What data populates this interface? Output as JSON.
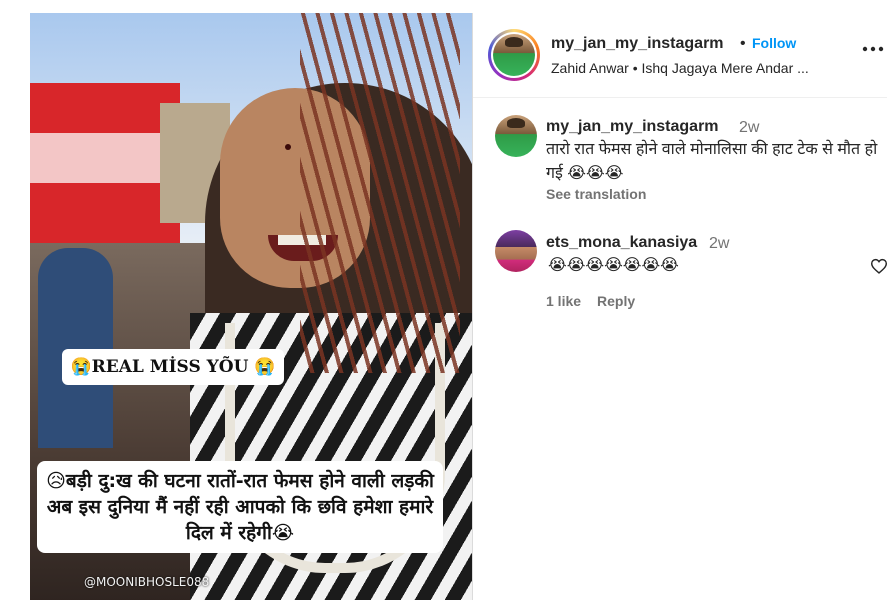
{
  "post": {
    "banner_top": "😭REAL MİSS YÕU 😭",
    "banner_bottom": "😥बड़ी दु:ख की घटना रातों-रात फेमस होने वाली लड़की अब इस दुनिया मैं नहीं रही आपको कि छवि हमेशा हमारे दिल में रहेगी😭",
    "watermark": "@MOONIBHOSLE088"
  },
  "header": {
    "username": "my_jan_my_instagarm",
    "dot": "•",
    "follow_label": "Follow",
    "subline": "Zahid Anwar • Ishq Jagaya Mere Andar ...",
    "more_icon": "more-horizontal-icon"
  },
  "comments": [
    {
      "username": "my_jan_my_instagarm",
      "time": "2w",
      "text": "तारो रात फेमस होने वाले मोनालिसा की हाट टेक से मौत हो गई 😭😭😭",
      "translate_label": "See translation"
    },
    {
      "username": "ets_mona_kanasiya",
      "time": "2w",
      "text": "😭😭😭😭😭😭😭",
      "likes": "1 like",
      "reply_label": "Reply",
      "like_icon": "heart-icon"
    }
  ],
  "colors": {
    "accent": "#0095f6",
    "text": "#262626",
    "muted": "#737373"
  }
}
